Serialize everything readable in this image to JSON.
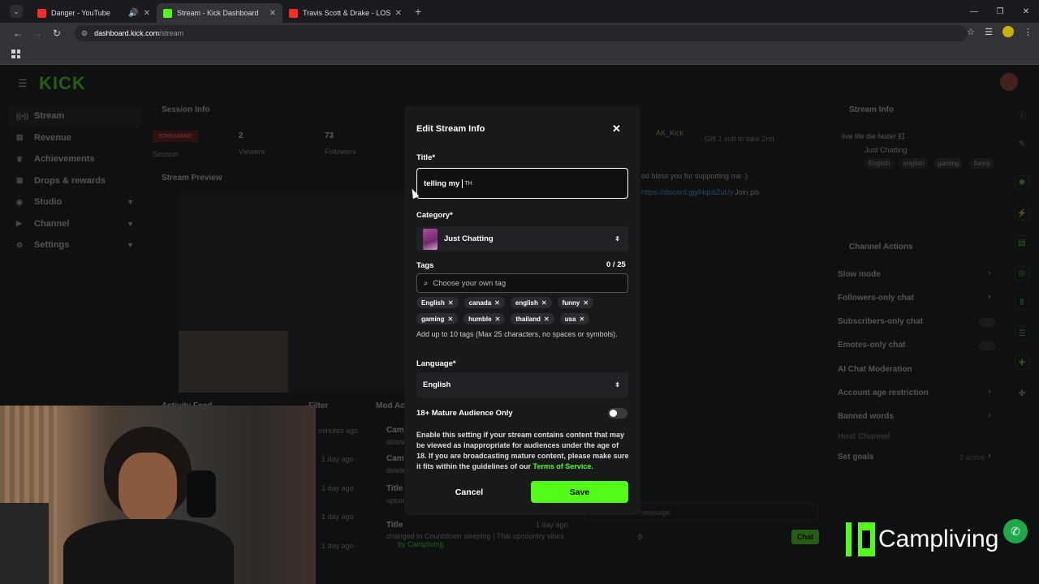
{
  "browser": {
    "tabs": [
      {
        "title": "Danger - YouTube",
        "icon": "youtube-icon"
      },
      {
        "title": "Stream - Kick Dashboard",
        "icon": "kick-icon"
      },
      {
        "title": "Travis Scott & Drake - LOST IT",
        "icon": "youtube-icon"
      }
    ],
    "url_host": "dashboard.kick.com",
    "url_path": "/stream"
  },
  "dashboard": {
    "logo": "KICK",
    "sidebar": [
      {
        "label": "Stream",
        "icon": "stream-icon",
        "expandable": false
      },
      {
        "label": "Revenue",
        "icon": "revenue-icon",
        "expandable": false
      },
      {
        "label": "Achievements",
        "icon": "trophy-icon",
        "expandable": false
      },
      {
        "label": "Drops & rewards",
        "icon": "gift-icon",
        "expandable": false
      },
      {
        "label": "Studio",
        "icon": "studio-icon",
        "expandable": true
      },
      {
        "label": "Channel",
        "icon": "channel-icon",
        "expandable": true
      },
      {
        "label": "Settings",
        "icon": "gear-icon",
        "expandable": true
      }
    ],
    "session_info": {
      "title": "Session Info",
      "status": "STREAMING",
      "viewers": "2",
      "followers": "73",
      "session_label": "Session",
      "viewers_label": "Viewers",
      "followers_label": "Followers"
    },
    "stream_preview_title": "Stream Preview",
    "activity_feed_title": "Activity Feed",
    "filter_label": "Filter",
    "mod_actions_title": "Mod Ac",
    "chat": {
      "user": "AK_Kick",
      "gift_text": "Gift 1 sub to take 2nd",
      "msg1": "od bless you for supporting me :)",
      "msg2_link": "https://discord.gg/Hqc6ZuUy",
      "msg2_rest": "Join pls",
      "input_placeholder": "message",
      "send_label": "Chat",
      "count": "0"
    },
    "stream_info_panel": {
      "title": "Stream Info",
      "stream_title": "live life die faster 红",
      "category": "Just Chatting",
      "tags": [
        "English",
        "english",
        "gaming",
        "funny"
      ]
    },
    "channel_actions": {
      "title": "Channel Actions",
      "items": [
        {
          "label": "Slow mode",
          "type": "chevron"
        },
        {
          "label": "Followers-only chat",
          "type": "chevron"
        },
        {
          "label": "Subscribers-only chat",
          "type": "toggle"
        },
        {
          "label": "Emotes-only chat",
          "type": "toggle"
        },
        {
          "label": "AI Chat Moderation",
          "type": "chart"
        },
        {
          "label": "Account age restriction",
          "type": "chevron"
        },
        {
          "label": "Banned words",
          "type": "chevron"
        },
        {
          "label": "Host Channel",
          "type": "none"
        },
        {
          "label": "Set goals",
          "type": "chevron"
        }
      ],
      "goals_active": "2 active"
    },
    "activity": {
      "times": [
        "minutes ago",
        "1 day ago",
        "1 day ago",
        "1 day ago",
        "1 day ago",
        "1 day ago"
      ],
      "mod_entries": [
        "Camp",
        "delete",
        "Camp",
        "delete",
        "Title",
        "upcoun",
        "Title"
      ],
      "last_title_change": "changed to Countdown sleeping | Thai upcountry vibes",
      "last_by": "by Campliving"
    }
  },
  "modal": {
    "title": "Edit Stream Info",
    "title_label": "Title*",
    "title_value": "telling my",
    "title_ime": "TH",
    "category_label": "Category*",
    "category_value": "Just Chatting",
    "tags_label": "Tags",
    "tags_count": "0 / 25",
    "tags_placeholder": "Choose your own tag",
    "tags": [
      "English",
      "canada",
      "english",
      "funny",
      "gaming",
      "humble",
      "thailand",
      "usa"
    ],
    "tags_help": "Add up to 10 tags (Max 25 characters, no spaces or symbols).",
    "language_label": "Language*",
    "language_value": "English",
    "mature_label": "18+ Mature Audience Only",
    "mature_desc": "Enable this setting if your stream contains content that may be viewed as inappropriate for audiences under the age of 18. If you are broadcasting mature content, please make sure it fits within the guidelines of our",
    "mature_link": "Terms of Service.",
    "cancel_label": "Cancel",
    "save_label": "Save"
  },
  "watermark": {
    "text": "Campliving"
  },
  "colors": {
    "accent": "#53fc18",
    "modal_bg": "#18191b",
    "page_bg": "#0f1011"
  }
}
